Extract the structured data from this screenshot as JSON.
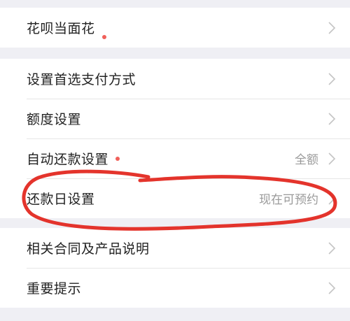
{
  "colors": {
    "background": "#efeff4",
    "card": "#ffffff",
    "text": "#222222",
    "secondary_text": "#9a9a9a",
    "red_dot": "#f0605a",
    "annotation_red": "#e2231a"
  },
  "groups": [
    {
      "rows": [
        {
          "label": "花呗当面花",
          "has_red_dot": true,
          "value": ""
        }
      ]
    },
    {
      "rows": [
        {
          "label": "设置首选支付方式",
          "has_red_dot": false,
          "value": ""
        },
        {
          "label": "额度设置",
          "has_red_dot": false,
          "value": ""
        },
        {
          "label": "自动还款设置",
          "has_red_dot": true,
          "value": "全额"
        },
        {
          "label": "还款日设置",
          "has_red_dot": false,
          "value": "现在可预约"
        }
      ]
    },
    {
      "rows": [
        {
          "label": "相关合同及产品说明",
          "has_red_dot": false,
          "value": ""
        },
        {
          "label": "重要提示",
          "has_red_dot": false,
          "value": ""
        }
      ]
    }
  ],
  "icons": {
    "chevron": "chevron-right-icon",
    "dot": "red-dot-icon"
  }
}
